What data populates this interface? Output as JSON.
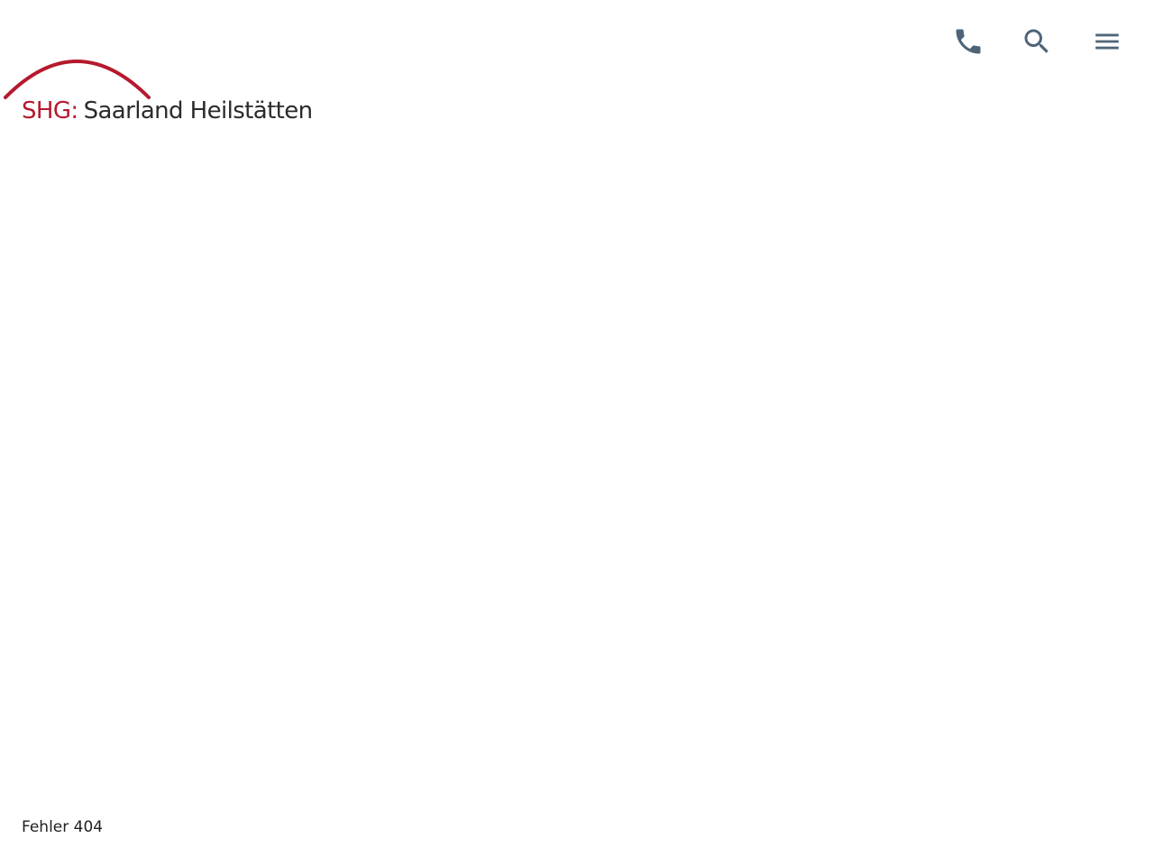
{
  "header": {
    "logo": {
      "brand": "SHG:",
      "name": "Saarland Heilstätten",
      "brand_color": "#b5192d",
      "arc_color": "#b5192d"
    },
    "icons": {
      "phone": "phone-icon",
      "search": "search-icon",
      "menu": "hamburger-menu-icon",
      "color": "#4d6478"
    }
  },
  "main": {
    "error_text": "Fehler 404"
  }
}
